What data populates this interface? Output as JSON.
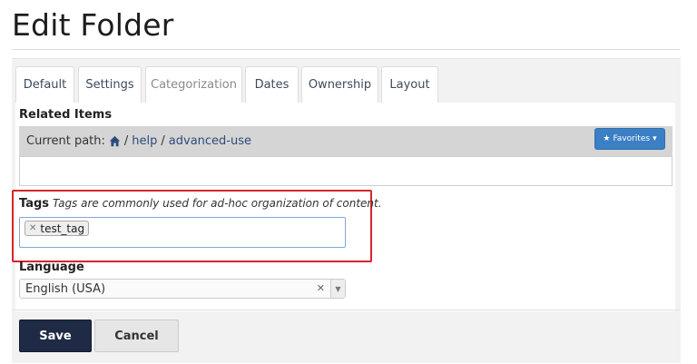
{
  "page": {
    "title": "Edit Folder"
  },
  "tabs": [
    {
      "label": "Default",
      "active": false
    },
    {
      "label": "Settings",
      "active": false
    },
    {
      "label": "Categorization",
      "active": true
    },
    {
      "label": "Dates",
      "active": false
    },
    {
      "label": "Ownership",
      "active": false
    },
    {
      "label": "Layout",
      "active": false
    }
  ],
  "related_items": {
    "label": "Related Items",
    "current_path_label": "Current path:",
    "path": [
      "help",
      "advanced-use"
    ],
    "separator": "/",
    "favorites_label": "Favorites",
    "input_value": ""
  },
  "tags": {
    "label": "Tags",
    "help": "Tags are commonly used for ad-hoc organization of content.",
    "values": [
      "test_tag"
    ],
    "highlight_color": "#d6262b"
  },
  "language": {
    "label": "Language",
    "selected": "English (USA)"
  },
  "actions": {
    "save_label": "Save",
    "cancel_label": "Cancel"
  },
  "colors": {
    "primary": "#1f2a44",
    "favorites": "#3b7fc4",
    "link": "#2d4b7a"
  }
}
